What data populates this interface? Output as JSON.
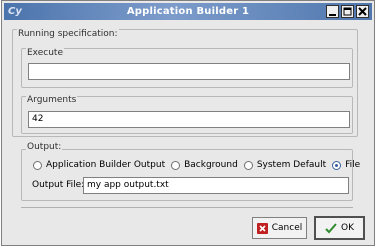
{
  "window": {
    "title": "Application Builder 1",
    "icon": "app-icon"
  },
  "running": {
    "group_label": "Running specification:",
    "execute_label": "Execute",
    "execute_value": "",
    "arguments_label": "Arguments",
    "arguments_value": "42"
  },
  "output": {
    "group_label": "Output:",
    "options": [
      {
        "label": "Application Builder Output",
        "selected": false
      },
      {
        "label": "Background",
        "selected": false
      },
      {
        "label": "System Default",
        "selected": false
      },
      {
        "label": "File",
        "selected": true
      }
    ],
    "file_label": "Output File:",
    "file_value": "my app output.txt"
  },
  "buttons": {
    "cancel_label": "Cancel",
    "ok_label": "OK"
  },
  "colors": {
    "titlebar": "#4b74ac",
    "cancel_icon": "#c02020",
    "ok_icon": "#2e8b2e"
  }
}
